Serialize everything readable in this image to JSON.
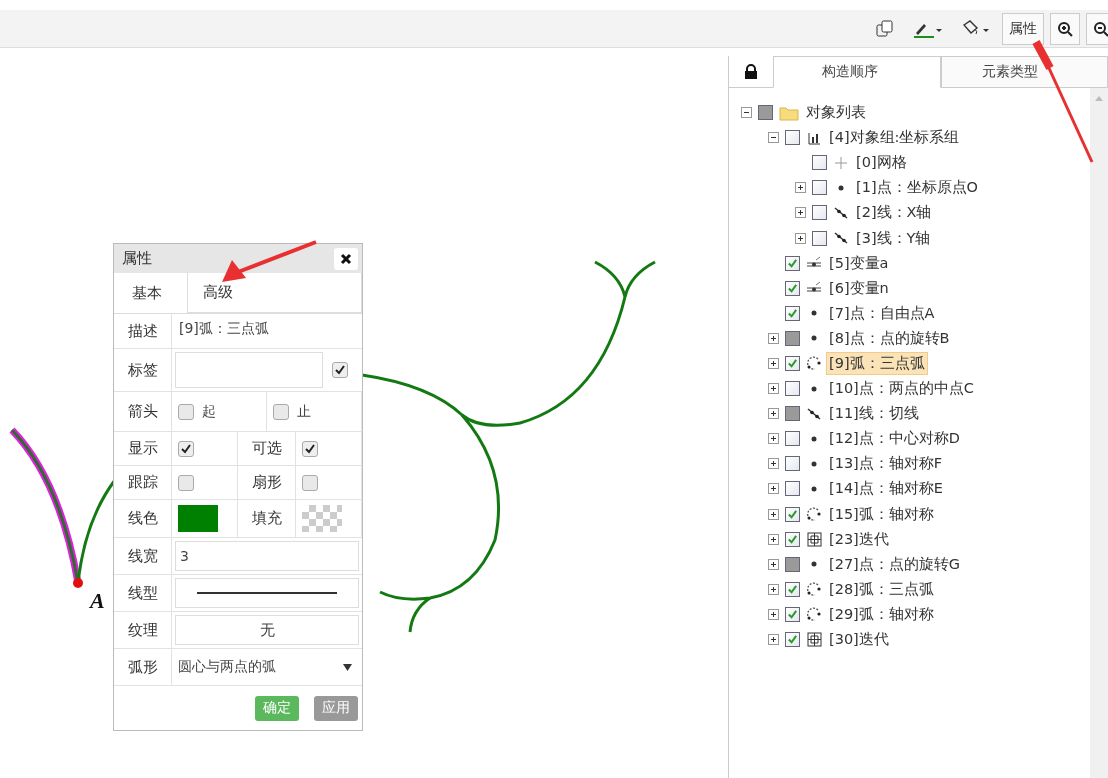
{
  "toolbar": {
    "property_button": "属性"
  },
  "canvas": {
    "point_label": "A"
  },
  "dialog": {
    "title": "属性",
    "tabs": [
      {
        "label": "基本",
        "selected": true
      },
      {
        "label": "高级",
        "selected": false
      }
    ],
    "rows": [
      {
        "kind": "text",
        "label": "描述",
        "value": "[9]弧：三点弧"
      },
      {
        "kind": "input_check",
        "label": "标签",
        "checked": true
      },
      {
        "kind": "check_labels",
        "label": "箭头",
        "options": [
          {
            "label": "起",
            "checked": false
          },
          {
            "label": "止",
            "checked": false
          }
        ]
      },
      {
        "kind": "check_pair",
        "items": [
          {
            "label": "显示",
            "checked": true
          },
          {
            "label": "可选",
            "checked": true
          }
        ]
      },
      {
        "kind": "check_pair",
        "items": [
          {
            "label": "跟踪",
            "checked": false
          },
          {
            "label": "扇形",
            "checked": false
          }
        ]
      },
      {
        "kind": "color_pair",
        "items": [
          {
            "label": "线色",
            "color": "#008000"
          },
          {
            "label": "填充"
          }
        ]
      },
      {
        "kind": "input",
        "label": "线宽",
        "value": "3"
      },
      {
        "kind": "line_style",
        "label": "线型"
      },
      {
        "kind": "button_field",
        "label": "纹理",
        "value": "无"
      },
      {
        "kind": "select",
        "label": "弧形",
        "value": "圆心与两点的弧"
      }
    ],
    "buttons": [
      {
        "label": "确定",
        "kind": "primary"
      },
      {
        "label": "应用",
        "kind": "secondary"
      }
    ]
  },
  "panel": {
    "tabs": [
      {
        "label": "构造顺序",
        "selected": true
      },
      {
        "label": "元素类型",
        "selected": false
      }
    ],
    "tree": [
      {
        "label": "对象列表",
        "kind": "folder",
        "expanded": true,
        "checked": false,
        "grayed": true,
        "selected": false,
        "children": [
          {
            "label": "[4]对象组:坐标系组",
            "kind": "group",
            "expanded": true,
            "checked": false,
            "grayed": false,
            "selected": false,
            "children": [
              {
                "label": "[0]网格",
                "kind": "grid",
                "checked": false,
                "grayed": false,
                "selected": false
              },
              {
                "label": "[1]点：坐标原点O",
                "kind": "point",
                "expanded": false,
                "checked": false,
                "grayed": false,
                "selected": false
              },
              {
                "label": "[2]线：X轴",
                "kind": "line",
                "expanded": false,
                "checked": false,
                "grayed": false,
                "selected": false
              },
              {
                "label": "[3]线：Y轴",
                "kind": "line",
                "expanded": false,
                "checked": false,
                "grayed": false,
                "selected": false
              }
            ]
          },
          {
            "label": "[5]变量a",
            "kind": "variable",
            "checked": true,
            "grayed": false,
            "selected": false
          },
          {
            "label": "[6]变量n",
            "kind": "variable",
            "checked": true,
            "grayed": false,
            "selected": false
          },
          {
            "label": "[7]点：自由点A",
            "kind": "point",
            "checked": true,
            "grayed": false,
            "selected": false
          },
          {
            "label": "[8]点：点的旋转B",
            "kind": "point",
            "expanded": false,
            "checked": false,
            "grayed": true,
            "selected": false
          },
          {
            "label": "[9]弧：三点弧",
            "kind": "arc",
            "expanded": false,
            "checked": true,
            "grayed": false,
            "selected": true
          },
          {
            "label": "[10]点：两点的中点C",
            "kind": "point",
            "expanded": false,
            "checked": false,
            "grayed": false,
            "selected": false
          },
          {
            "label": "[11]线：切线",
            "kind": "line",
            "expanded": false,
            "checked": false,
            "grayed": true,
            "selected": false
          },
          {
            "label": "[12]点：中心对称D",
            "kind": "point",
            "expanded": false,
            "checked": false,
            "grayed": false,
            "selected": false
          },
          {
            "label": "[13]点：轴对称F",
            "kind": "point",
            "expanded": false,
            "checked": false,
            "grayed": false,
            "selected": false
          },
          {
            "label": "[14]点：轴对称E",
            "kind": "point",
            "expanded": false,
            "checked": false,
            "grayed": false,
            "selected": false
          },
          {
            "label": "[15]弧：轴对称",
            "kind": "arc",
            "expanded": false,
            "checked": true,
            "grayed": false,
            "selected": false
          },
          {
            "label": "[23]迭代",
            "kind": "iteration",
            "expanded": false,
            "checked": true,
            "grayed": false,
            "selected": false
          },
          {
            "label": "[27]点：点的旋转G",
            "kind": "point",
            "expanded": false,
            "checked": false,
            "grayed": true,
            "selected": false
          },
          {
            "label": "[28]弧：三点弧",
            "kind": "arc",
            "expanded": false,
            "checked": true,
            "grayed": false,
            "selected": false
          },
          {
            "label": "[29]弧：轴对称",
            "kind": "arc",
            "expanded": false,
            "checked": true,
            "grayed": false,
            "selected": false
          },
          {
            "label": "[30]迭代",
            "kind": "iteration",
            "expanded": false,
            "checked": true,
            "grayed": false,
            "selected": false
          }
        ]
      }
    ]
  }
}
